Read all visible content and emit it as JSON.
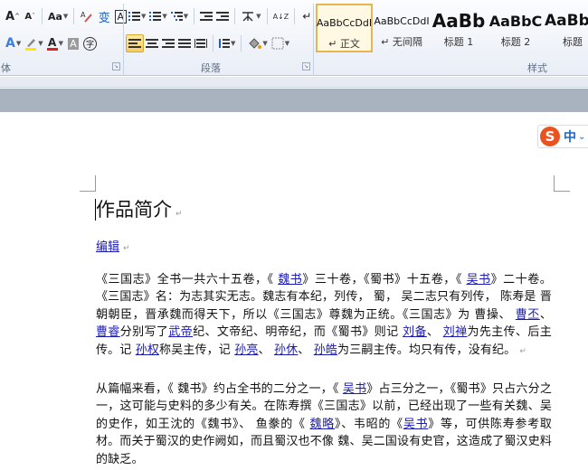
{
  "ribbon": {
    "font_group": {
      "label": "体",
      "grow_font": "A",
      "shrink_font": "A",
      "change_case": "Aa",
      "phonetic": "变",
      "char_border": "A",
      "text_effect": "A",
      "highlight": "ab",
      "font_color": "A",
      "char_shading": "A",
      "enclose": "字"
    },
    "paragraph_group": {
      "label": "段落",
      "sort": "A↓Z",
      "show_marks": "↵"
    },
    "styles_group": {
      "label": "样式",
      "items": [
        {
          "sample": "AaBbCcDdI",
          "name": "↵ 正文",
          "selected": true
        },
        {
          "sample": "AaBbCcDdI",
          "name": "↵ 无间隔",
          "selected": false
        },
        {
          "sample": "AaBb",
          "name": "标题 1",
          "selected": false
        },
        {
          "sample": "AaBbC",
          "name": "标题 2",
          "selected": false
        },
        {
          "sample": "AaBb",
          "name": "标题",
          "selected": false
        }
      ]
    }
  },
  "ime": {
    "text": "中",
    "extra": "⌄"
  },
  "document": {
    "title": "作品简介",
    "edit_link": "编辑",
    "para1": {
      "t1": "《三国志》全书一共六十五卷，《 ",
      "l1": "魏书",
      "t2": "》三十卷，《蜀书》十五卷，《 ",
      "l2": "吴书",
      "t3": "》二十卷。《三国志》名：为志其实无志。魏志有本纪，列传， 蜀， 吴二志只有列传， 陈寿是 晋朝朝臣，晋承魏而得天下，所以《三国志》尊魏为正统。《三国志》为 曹操、 ",
      "l3": "曹丕",
      "t4": "、 ",
      "l4": "曹睿",
      "t5": "分别写了",
      "l5": "武帝",
      "t6": "纪、文帝纪、明帝纪，而《蜀书》则记 ",
      "l6": "刘备",
      "t7": "、 ",
      "l7": "刘禅",
      "t8": "为先主传、后主传。记 ",
      "l8": "孙权",
      "t9": "称吴主传，记 ",
      "l9": "孙亮",
      "t10": "、 ",
      "l10": "孙休",
      "t11": "、 ",
      "l11": "孙皓",
      "t12": "为三嗣主传。均只有传，没有纪。"
    },
    "para2": {
      "t1": "从篇幅来看，《 魏书》约占全书的二分之一，《 ",
      "l1": "吴书",
      "t2": "》占三分之一，《蜀书》只占六分之一，这可能与史料的多少有关。在陈寿撰《三国志》以前，已经出现了一些有关魏、吴的史作，如王沈的《魏书》、 鱼豢的《 ",
      "l2": "魏略",
      "t3": "》、韦昭的《",
      "l3": "吴书",
      "t4": "》等，可供陈寿参考取材。而关于蜀汉的史作阙如，而且蜀汉也不像 魏、吴二国设有史官，这造成了蜀汉史料的缺乏。"
    }
  },
  "colors": {
    "link": "#1a1ab4",
    "accent": "#f7cf5f",
    "ime_logo": "#e8531f"
  }
}
